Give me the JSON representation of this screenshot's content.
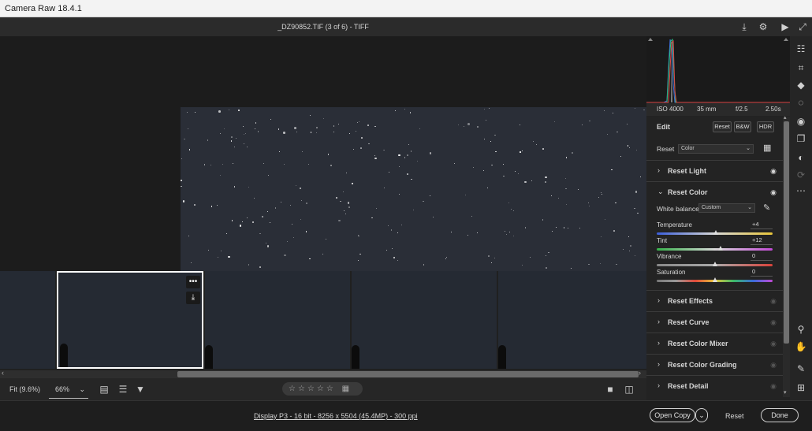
{
  "window": {
    "title": "Camera Raw 18.4.1"
  },
  "topbar": {
    "filename": "_DZ90852.TIF (3 of 6)  -  TIFF",
    "icons": [
      "save-icon",
      "gear-icon",
      "slideshow-icon",
      "fullscreen-icon"
    ]
  },
  "filmstrip": {
    "thumbnails": 5,
    "selected_index": 1,
    "more_glyph": "•••",
    "save_glyph": "⤓"
  },
  "bottombar": {
    "fit_label": "Fit (9.6%)",
    "zoom_value": "66%",
    "rating_stars": "☆☆☆☆☆",
    "rating_max": 5,
    "rating_value": 0
  },
  "footer": {
    "info": "Display P3 - 16 bit - 8256 x 5504 (45.4MP) - 300 ppi",
    "open_copy_label": "Open Copy",
    "reset_label": "Reset",
    "done_label": "Done"
  },
  "histogram": {
    "exif": {
      "iso": "ISO 4000",
      "focal": "35 mm",
      "aperture": "f/2.5",
      "shutter": "2.50s"
    }
  },
  "edit": {
    "title": "Edit",
    "reset_label": "Reset",
    "bw_label": "B&W",
    "hdr_label": "HDR",
    "profile_label": "Reset",
    "profile_value": "Color"
  },
  "sections": {
    "light": "Reset Light",
    "color": "Reset Color",
    "effects": "Reset Effects",
    "curve": "Reset Curve",
    "color_mixer": "Reset Color Mixer",
    "color_grading": "Reset Color Grading",
    "detail": "Reset Detail"
  },
  "color": {
    "wb_label": "White balance",
    "wb_value": "Custom",
    "sliders": [
      {
        "name": "Temperature",
        "value": "+4",
        "pos": 0.51
      },
      {
        "name": "Tint",
        "value": "+12",
        "pos": 0.55
      },
      {
        "name": "Vibrance",
        "value": "0",
        "pos": 0.5
      },
      {
        "name": "Saturation",
        "value": "0",
        "pos": 0.5
      }
    ]
  },
  "colors": {
    "accent": "#ffffff",
    "panel": "#232323",
    "background": "#1e1e1e"
  }
}
